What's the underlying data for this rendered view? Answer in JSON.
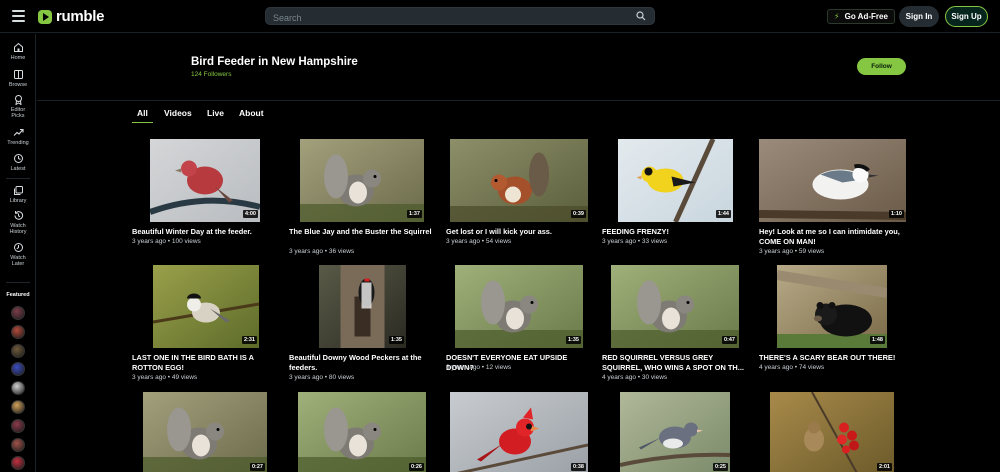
{
  "header": {
    "logo_text": "rumble",
    "search_placeholder": "Search",
    "adfree_label": "Go Ad-Free",
    "signin_label": "Sign In",
    "signup_label": "Sign Up"
  },
  "sidebar": {
    "items": [
      {
        "label": "Home",
        "icon": "home-icon"
      },
      {
        "label": "Browse",
        "icon": "browse-icon"
      },
      {
        "label": "Editor Picks",
        "icon": "editor-picks-icon"
      },
      {
        "label": "Trending",
        "icon": "trending-icon"
      },
      {
        "label": "Latest",
        "icon": "clock-icon"
      },
      {
        "label": "Library",
        "icon": "library-icon"
      },
      {
        "label": "Watch History",
        "icon": "history-icon"
      },
      {
        "label": "Watch Later",
        "icon": "watch-later-icon"
      }
    ],
    "featured_title": "Featured",
    "featured_avatar_colors": [
      "#7a3d4a",
      "#b04a3a",
      "#6e5a3a",
      "#3b4cc0",
      "#d0d0d0",
      "#cfa05a",
      "#8a3a4a",
      "#a0524a",
      "#c03040"
    ]
  },
  "channel": {
    "name": "Bird Feeder in New Hampshire",
    "followers": "124 Followers",
    "follow_label": "Follow"
  },
  "tabs": [
    {
      "label": "All",
      "active": true
    },
    {
      "label": "Videos",
      "active": false
    },
    {
      "label": "Live",
      "active": false
    },
    {
      "label": "About",
      "active": false
    }
  ],
  "videos": [
    {
      "title": "Beautiful Winter Day at the feeder.",
      "meta": "3 years ago • 100 views",
      "duration": "4:00",
      "scene": "finch"
    },
    {
      "title": "The Blue Jay and the Buster the Squirrel",
      "meta": "3 years ago • 36 views",
      "duration": "1:37",
      "scene": "squirrel-grey"
    },
    {
      "title": "Get lost or I will kick your ass.",
      "meta": "3 years ago • 54 views",
      "duration": "0:39",
      "scene": "squirrel-red"
    },
    {
      "title": "FEEDING FRENZY!",
      "meta": "3 years ago • 33 views",
      "duration": "1:44",
      "scene": "goldfinch"
    },
    {
      "title": "Hey! Look at me so I can intimidate you, COME ON MAN!",
      "meta": "3 years ago • 59 views",
      "duration": "1:10",
      "scene": "nuthatch"
    },
    {
      "title": "LAST ONE IN THE BIRD BATH IS A ROTTON EGG!",
      "meta": "3 years ago • 49 views",
      "duration": "2:31",
      "scene": "chickadee"
    },
    {
      "title": "Beautiful Downy Wood Peckers at the feeders.",
      "meta": "3 years ago • 80 views",
      "duration": "1:35",
      "scene": "woodpecker"
    },
    {
      "title": "DOESN'T EVERYONE EAT UPSIDE DOWN?",
      "meta": "3 years ago • 12 views",
      "duration": "1:35",
      "scene": "squirrel-grey2"
    },
    {
      "title": "RED SQUIRREL VERSUS GREY SQUIRREL, WHO WINS A SPOT ON TH...",
      "meta": "4 years ago • 30 views",
      "duration": "0:47",
      "scene": "squirrel-grey2"
    },
    {
      "title": "THERE'S A SCARY BEAR OUT THERE!",
      "meta": "4 years ago • 74 views",
      "duration": "1:48",
      "scene": "bear"
    },
    {
      "title": "",
      "meta": "",
      "duration": "0:27",
      "scene": "squirrel-grey"
    },
    {
      "title": "",
      "meta": "",
      "duration": "0:26",
      "scene": "squirrel-grey2"
    },
    {
      "title": "",
      "meta": "",
      "duration": "0:38",
      "scene": "cardinal"
    },
    {
      "title": "",
      "meta": "",
      "duration": "0:25",
      "scene": "junco"
    },
    {
      "title": "",
      "meta": "",
      "duration": "2:01",
      "scene": "sparrow"
    }
  ],
  "colors": {
    "accent": "#85c742",
    "background": "#000000",
    "search_bg": "#252d33"
  }
}
